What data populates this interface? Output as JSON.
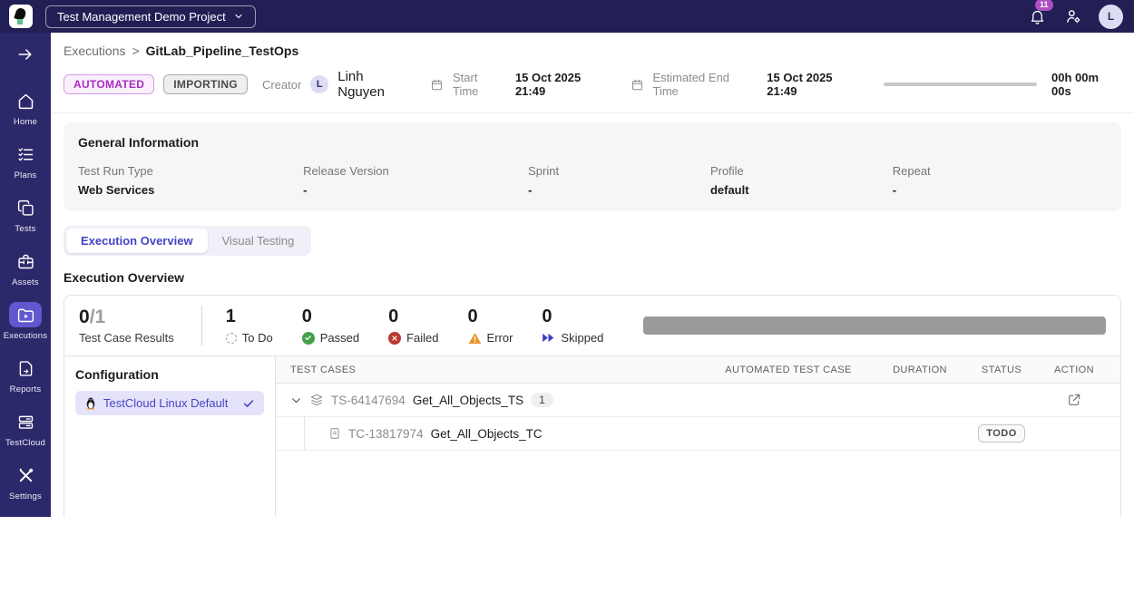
{
  "colors": {
    "accent": "#4644C5",
    "purple_badge": "#A62CC2",
    "passed_green": "#43A047",
    "failed_red": "#B93A32",
    "error_orange": "#E8962E",
    "progress_gray": "#9A9A9A",
    "topbar_navy": "#221F55",
    "sidebar_navy": "#2C296A"
  },
  "topbar": {
    "project_selector": "Test Management Demo Project",
    "notification_count": "11",
    "avatar_initial": "L"
  },
  "sidebar": {
    "items": [
      {
        "label": "Home",
        "icon": "home-icon"
      },
      {
        "label": "Plans",
        "icon": "plans-icon"
      },
      {
        "label": "Tests",
        "icon": "tests-icon"
      },
      {
        "label": "Assets",
        "icon": "assets-icon"
      },
      {
        "label": "Executions",
        "icon": "executions-icon",
        "active": true
      },
      {
        "label": "Reports",
        "icon": "reports-icon"
      },
      {
        "label": "TestCloud",
        "icon": "testcloud-icon"
      },
      {
        "label": "Settings",
        "icon": "settings-icon"
      }
    ]
  },
  "header": {
    "breadcrumb": {
      "parent": "Executions",
      "separator": ">",
      "current": "GitLab_Pipeline_TestOps"
    },
    "badges": [
      {
        "label": "AUTOMATED",
        "style": "purple"
      },
      {
        "label": "IMPORTING",
        "style": "gray"
      }
    ],
    "creator": {
      "label": "Creator",
      "initial": "L",
      "name": "Linh Nguyen"
    },
    "start_time": {
      "label": "Start Time",
      "value": "15 Oct 2025 21:49"
    },
    "estimated_end_time": {
      "label": "Estimated End Time",
      "value": "15 Oct 2025 21:49"
    },
    "elapsed": "00h 00m 00s"
  },
  "general_info": {
    "title": "General Information",
    "fields": [
      {
        "label": "Test Run Type",
        "value": "Web Services"
      },
      {
        "label": "Release Version",
        "value": "-"
      },
      {
        "label": "Sprint",
        "value": "-"
      },
      {
        "label": "Profile",
        "value": "default"
      },
      {
        "label": "Repeat",
        "value": "-"
      }
    ]
  },
  "tabs": [
    {
      "label": "Execution Overview",
      "active": true
    },
    {
      "label": "Visual Testing",
      "active": false
    }
  ],
  "section_title": "Execution Overview",
  "summary": {
    "results": {
      "completed": "0",
      "total_display": "/1",
      "label": "Test Case Results"
    },
    "stats": [
      {
        "value": "1",
        "label": "To Do",
        "icon": "todo-icon"
      },
      {
        "value": "0",
        "label": "Passed",
        "icon": "passed-icon"
      },
      {
        "value": "0",
        "label": "Failed",
        "icon": "failed-icon"
      },
      {
        "value": "0",
        "label": "Error",
        "icon": "error-icon"
      },
      {
        "value": "0",
        "label": "Skipped",
        "icon": "skipped-icon"
      }
    ]
  },
  "configuration": {
    "title": "Configuration",
    "items": [
      {
        "name": "TestCloud Linux Default",
        "os": "linux",
        "selected": true
      }
    ]
  },
  "table": {
    "columns": [
      "TEST CASES",
      "AUTOMATED TEST CASE",
      "DURATION",
      "STATUS",
      "ACTION"
    ],
    "suite": {
      "id": "TS-64147694",
      "name": "Get_All_Objects_TS",
      "count": "1"
    },
    "case": {
      "id": "TC-13817974",
      "name": "Get_All_Objects_TC",
      "status": "TODO"
    }
  }
}
